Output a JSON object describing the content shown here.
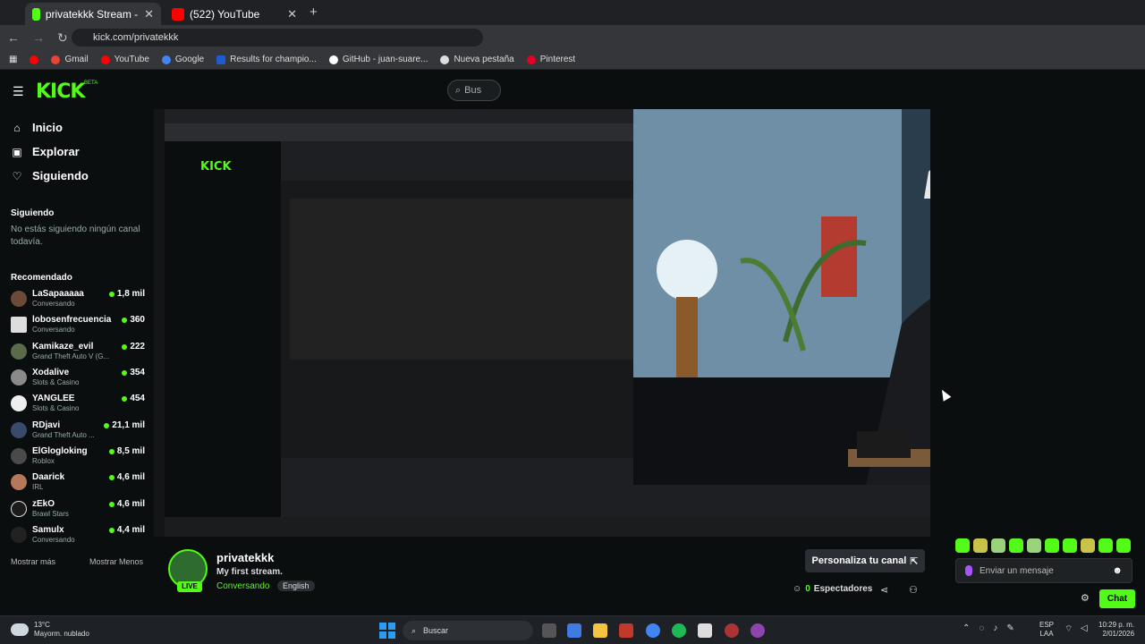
{
  "browser": {
    "tabs": [
      {
        "title": "privatekkk Stream - Watch Live",
        "active": true
      },
      {
        "title": "(522) YouTube",
        "active": false
      }
    ],
    "new_tab": "+",
    "url": "kick.com/privatekkk",
    "bookmarks": [
      "Gmail",
      "YouTube",
      "Google",
      "Results for champio...",
      "GitHub - juan-suare...",
      "Nueva pestaña",
      "Pinterest"
    ]
  },
  "kick": {
    "logo": "KICK",
    "beta": "BETA",
    "search_placeholder": "Bus"
  },
  "sidebar": {
    "nav": [
      {
        "label": "Inicio",
        "icon": "home-icon"
      },
      {
        "label": "Explorar",
        "icon": "compass-icon"
      },
      {
        "label": "Siguiendo",
        "icon": "heart-icon"
      }
    ],
    "following_title": "Siguiendo",
    "following_empty": "No estás siguiendo ningún canal todavía.",
    "recommended_title": "Recomendado",
    "recommended": [
      {
        "name": "LaSapaaaaa",
        "category": "Conversando",
        "viewers": "1,8 mil"
      },
      {
        "name": "lobosenfrecuencia",
        "category": "Conversando",
        "viewers": "360"
      },
      {
        "name": "Kamikaze_evil",
        "category": "Grand Theft Auto V (G...",
        "viewers": "222"
      },
      {
        "name": "Xodalive",
        "category": "Slots & Casino",
        "viewers": "354"
      },
      {
        "name": "YANGLEE",
        "category": "Slots & Casino",
        "viewers": "454"
      },
      {
        "name": "RDjavi",
        "category": "Grand Theft Auto ...",
        "viewers": "21,1 mil"
      },
      {
        "name": "ElGlogloking",
        "category": "Roblox",
        "viewers": "8,5 mil"
      },
      {
        "name": "Daarick",
        "category": "IRL",
        "viewers": "4,6 mil"
      },
      {
        "name": "zEkO",
        "category": "Brawl Stars",
        "viewers": "4,6 mil"
      },
      {
        "name": "Samulx",
        "category": "Conversando",
        "viewers": "4,4 mil"
      }
    ],
    "show_more": "Mostrar más",
    "show_less": "Mostrar Menos"
  },
  "channel": {
    "name": "privatekkk",
    "live_badge": "LIVE",
    "title": "My first stream.",
    "category": "Conversando",
    "language": "English",
    "customize_label": "Personaliza tu canal",
    "viewers_count": "0",
    "viewers_label": "Espectadores"
  },
  "chat": {
    "placeholder": "Enviar un mensaje",
    "chat_button": "Chat"
  },
  "taskbar": {
    "weather_temp": "13°C",
    "weather_desc": "Mayorm. nublado",
    "search_label": "Buscar",
    "lang_top": "ESP",
    "lang_bottom": "LAA",
    "time": "10:29 p. m.",
    "date": "2/01/2026"
  },
  "colors": {
    "kick_green": "#53fc18",
    "background": "#0b0e0f"
  }
}
